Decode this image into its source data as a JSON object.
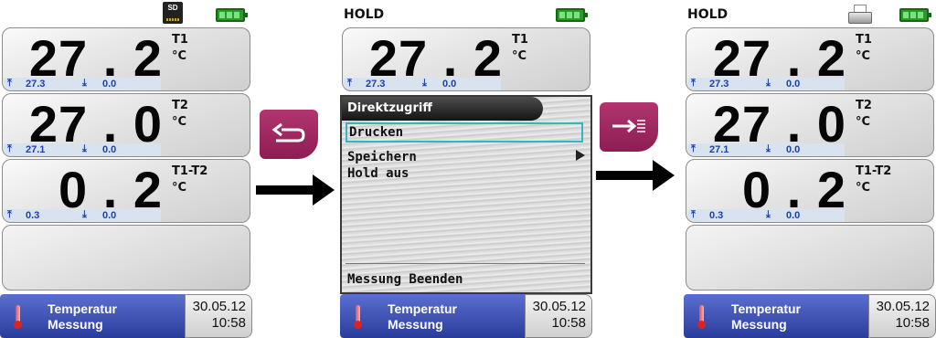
{
  "status": {
    "hold_label": "HOLD",
    "sd_label": "SD"
  },
  "colors": {
    "accent_purple": "#a0285f",
    "footer_blue": "#3a4db5",
    "minmax_blue": "#1c3faa",
    "highlight_cyan": "#37b4c4"
  },
  "panels": {
    "t1": {
      "value": "27 . 2",
      "name": "T1",
      "unit": "°C",
      "max": "27.3",
      "min": "0.0"
    },
    "t2": {
      "value": "27 . 0",
      "name": "T2",
      "unit": "°C",
      "max": "27.1",
      "min": "0.0"
    },
    "diff": {
      "value": "0 . 2",
      "name": "T1-T2",
      "unit": "°C",
      "max": "0.3",
      "min": "0.0"
    }
  },
  "menu": {
    "header": "Direktzugriff",
    "items": [
      "Drucken",
      "Speichern",
      "Hold aus"
    ],
    "selected_item": "Drucken",
    "exit_item": "Messung Beenden"
  },
  "footer": {
    "line1": "Temperatur",
    "line2": "Messung",
    "date": "30.05.12",
    "time": "10:58"
  },
  "icons": {
    "battery": "battery-full-icon",
    "sd": "sd-card-icon",
    "printer": "printer-icon",
    "max": "arrow-up-max-icon",
    "min": "arrow-down-min-icon",
    "thermometer": "thermometer-icon",
    "back_key": "return-arrow-icon",
    "print_key": "arrow-to-list-icon",
    "flow_arrow": "right-arrow-icon",
    "submenu": "triangle-right-icon"
  }
}
